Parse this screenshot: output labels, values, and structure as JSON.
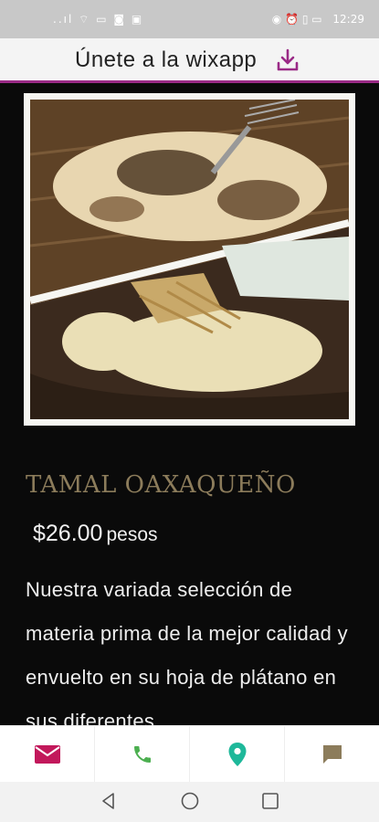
{
  "status_bar": {
    "left_icons": "..ıl ⌔ ▭ ◙ ▣",
    "right_icons": "◉ ⏰ ▯ ▭",
    "time": "12:29"
  },
  "banner": {
    "text": "Únete a la wixapp"
  },
  "product": {
    "title": "TAMAL OAXAQUEÑO",
    "price": "$26.00",
    "price_unit": "pesos",
    "description": "Nuestra variada selección de materia prima de la mejor calidad y envuelto en su hoja de plátano en sus diferentes"
  },
  "bottom_bar": {
    "icons": [
      "mail-icon",
      "phone-icon",
      "location-pin-icon",
      "chat-icon"
    ],
    "colors": {
      "mail": "#c2185b",
      "phone": "#4caf50",
      "location": "#1eb89a",
      "chat": "#8c7c5b"
    }
  },
  "nav_bar": {
    "icons": [
      "back-icon",
      "home-icon",
      "recents-icon"
    ]
  }
}
